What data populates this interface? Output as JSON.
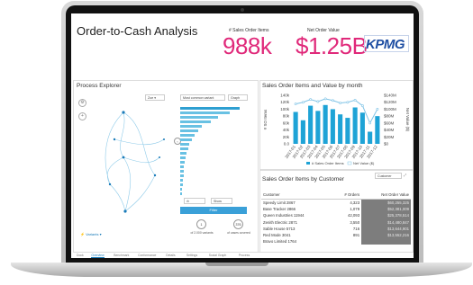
{
  "app": {
    "title": "Order-to-Cash Analysis",
    "logo": "KPMG"
  },
  "kpis": [
    {
      "label": "# Sales Order Items",
      "value": "988k"
    },
    {
      "label": "Net Order Value",
      "value": "$1.25B"
    }
  ],
  "process_explorer": {
    "title": "Process Explorer",
    "zoom_label": "Zoe",
    "show_label": "Show",
    "apply_label": "Filter",
    "selects": [
      "Most common variant",
      "Graph"
    ],
    "stats": [
      {
        "value": "1",
        "caption": "of 2.000 variants"
      },
      {
        "value": "376",
        "caption": "of cases covered"
      }
    ],
    "variants_label": "Variants",
    "bars": [
      0.92,
      0.76,
      0.58,
      0.47,
      0.34,
      0.28,
      0.22,
      0.18,
      0.14,
      0.12,
      0.1,
      0.08,
      0.07,
      0.06,
      0.05,
      0.05,
      0.04,
      0.04,
      0.03,
      0.03
    ],
    "dark_bars": [
      0
    ]
  },
  "chart_data": {
    "type": "bar",
    "title": "Sales Order Items and Value by month",
    "categories": [
      "2017-01",
      "2017-02",
      "2017-03",
      "2017-04",
      "2017-05",
      "2017-06",
      "2017-07",
      "2017-08",
      "2017-09",
      "2017-10",
      "2017-11",
      "2017-12"
    ],
    "series": [
      {
        "name": "# Sales Order Items",
        "type": "bar",
        "axis": "left",
        "values": [
          92,
          68,
          110,
          95,
          112,
          100,
          85,
          75,
          105,
          90,
          35,
          80
        ]
      },
      {
        "name": "Net Value ($)",
        "type": "line",
        "axis": "right",
        "values": [
          115,
          120,
          128,
          122,
          130,
          125,
          118,
          120,
          126,
          110,
          60,
          100
        ]
      }
    ],
    "ylabel": "# SO Items",
    "y2label": "Net Value ($)",
    "ylim": [
      0,
      140
    ],
    "y2lim": [
      0,
      140
    ],
    "yticks": [
      "140k",
      "120k",
      "100k",
      "80k",
      "60k",
      "40k",
      "20k",
      "0.0"
    ],
    "y2ticks": [
      "$140M",
      "$120M",
      "$100M",
      "$80M",
      "$60M",
      "$40M",
      "$20M",
      "$0"
    ],
    "xticklabels": [
      "2017-01",
      "2017-02",
      "2017-03",
      "2017-04",
      "2017-05",
      "2017-06",
      "2017-07",
      "2017-08",
      "2017-09",
      "2017-10",
      "2017-11",
      "2017-12"
    ],
    "legend_position": "bottom",
    "colors": {
      "bar": "#1ea3d6",
      "line": "#7fc3e6"
    }
  },
  "customer_table": {
    "title": "Sales Order Items by Customer",
    "filter_label": "Customer",
    "columns": [
      "Customer",
      "# Orders",
      "Net Order Value"
    ],
    "rows": [
      {
        "customer": "Speedy Limit 2867",
        "orders": "4,323",
        "value": "$60,255,325"
      },
      {
        "customer": "Base Tracker 2866",
        "orders": "1,079",
        "value": "$52,381,009"
      },
      {
        "customer": "Queen Industries 11944",
        "orders": "42,093",
        "value": "$25,378,514"
      },
      {
        "customer": "Zenith Electric 2871",
        "orders": "3,550",
        "value": "$14,480,847"
      },
      {
        "customer": "Sable House 5713",
        "orders": "716",
        "value": "$13,644,901"
      },
      {
        "customer": "Red Mode 3041",
        "orders": "891",
        "value": "$13,552,216"
      },
      {
        "customer": "Bravo Limited 1764",
        "orders": "",
        "value": ""
      }
    ]
  },
  "tabs": [
    "Dock",
    "Overview",
    "Benchmark",
    "Conformance",
    "Details",
    "Settings",
    "Social Graph",
    "Process"
  ],
  "active_tab": 1,
  "colors": {
    "accent": "#e0297a",
    "brand": "#1f4fa3",
    "primary": "#1ea3d6"
  }
}
